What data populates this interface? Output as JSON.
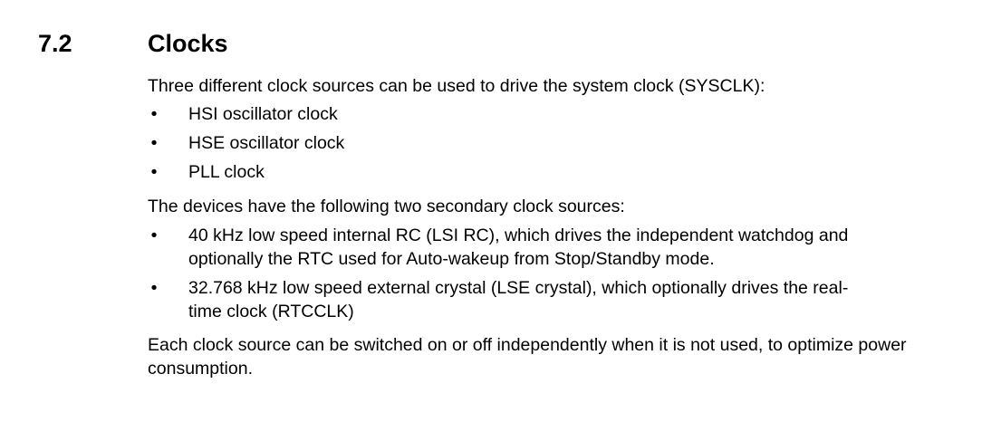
{
  "section": {
    "number": "7.2",
    "title": "Clocks"
  },
  "intro_text": "Three different clock sources can be used to drive the system clock (SYSCLK):",
  "system_clock_sources": [
    "HSI oscillator clock",
    "HSE oscillator clock",
    "PLL clock"
  ],
  "secondary_intro_text": "The devices have the following two secondary clock sources:",
  "secondary_clock_sources": [
    "40 kHz low speed internal RC (LSI RC), which drives the independent watchdog and optionally the RTC used for Auto-wakeup from Stop/Standby mode.",
    "32.768 kHz low speed external crystal (LSE crystal), which optionally drives the real-time clock (RTCCLK)"
  ],
  "closing_text": "Each clock source can be switched on or off independently when it is not used, to optimize power consumption.",
  "bullet_glyph": "•"
}
